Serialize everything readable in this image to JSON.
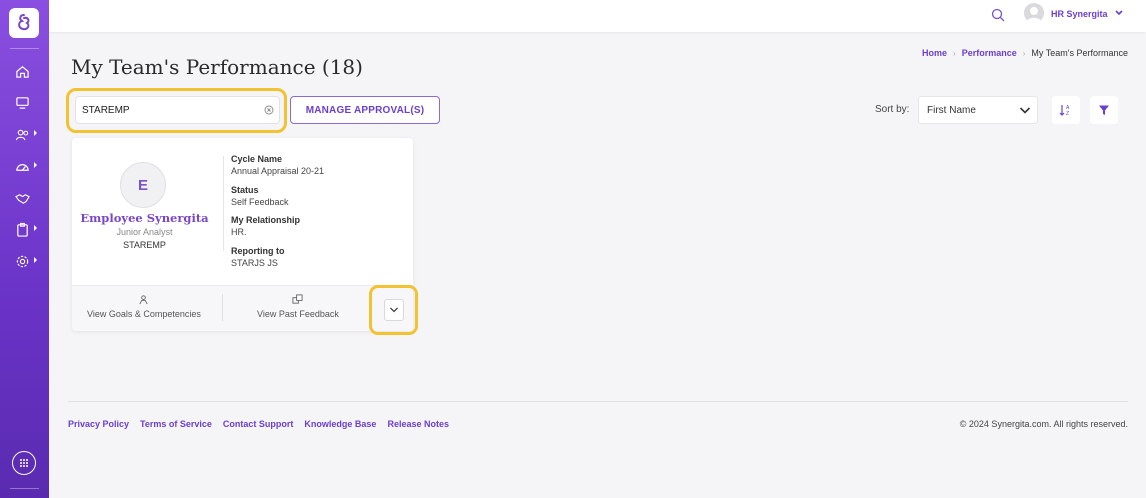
{
  "header": {
    "user_name": "HR Synergita"
  },
  "breadcrumb": {
    "home": "Home",
    "performance": "Performance",
    "current": "My Team's Performance"
  },
  "page": {
    "title": "My Team's Performance (18)"
  },
  "toolbar": {
    "search_value": "STAREMP",
    "manage_label": "MANAGE APPROVAL(S)",
    "sort_label": "Sort by:",
    "sort_value": "First Name"
  },
  "card": {
    "initial": "E",
    "name": "Employee Synergita",
    "role": "Junior Analyst",
    "code": "STAREMP",
    "fields": [
      {
        "label": "Cycle Name",
        "value": "Annual Appraisal 20-21"
      },
      {
        "label": "Status",
        "value": "Self Feedback"
      },
      {
        "label": "My Relationship",
        "value": "HR."
      },
      {
        "label": "Reporting to",
        "value": "STARJS JS"
      }
    ],
    "actions": {
      "goals": "View Goals & Competencies",
      "past_feedback": "View Past Feedback"
    }
  },
  "footer": {
    "links": [
      "Privacy Policy",
      "Terms of Service",
      "Contact Support",
      "Knowledge Base",
      "Release Notes"
    ],
    "copyright": "© 2024 Synergita.com. All rights reserved."
  },
  "colors": {
    "brand": "#6b3fd0",
    "highlight": "#f2c230",
    "sidebar_top": "#8a4fe0",
    "sidebar_bottom": "#5a2bb0"
  },
  "icons": {
    "sidebar": [
      "home-icon",
      "monitor-icon",
      "team-icon",
      "dashboard-icon",
      "handshake-icon",
      "clipboard-icon",
      "settings-icon"
    ],
    "top": [
      "search-icon",
      "avatar-icon",
      "chevron-down-icon"
    ]
  }
}
